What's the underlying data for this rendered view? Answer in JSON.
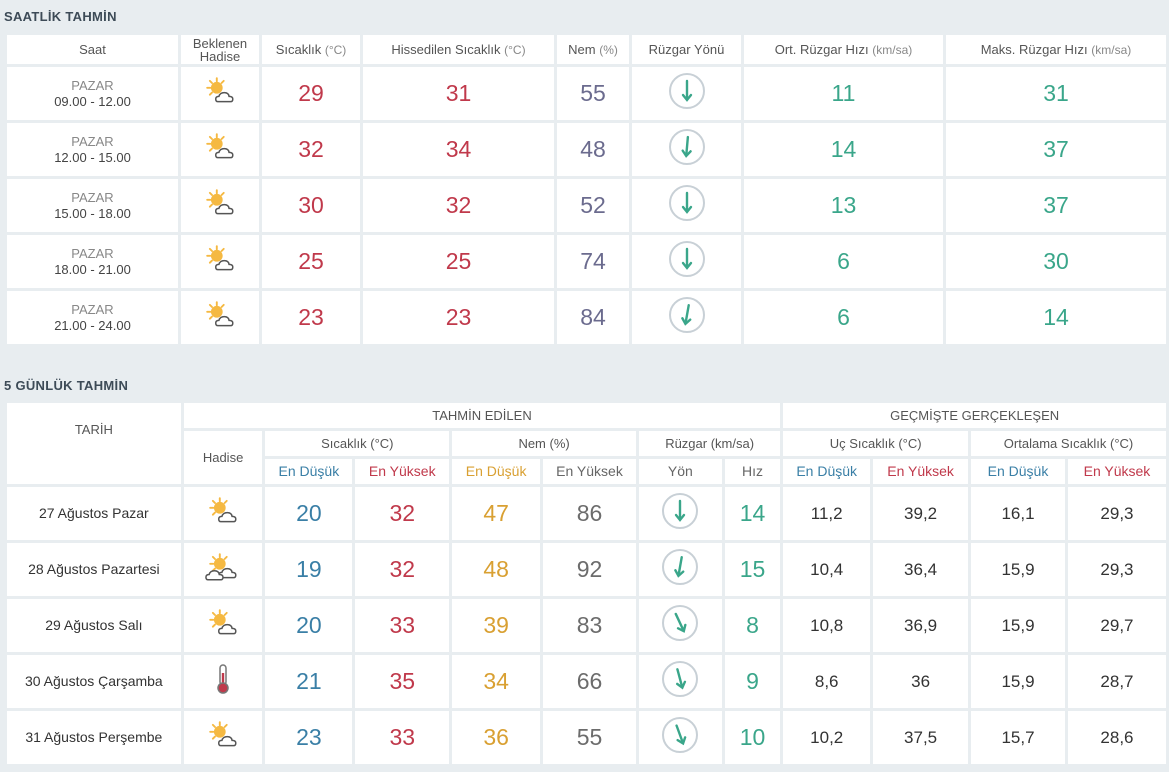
{
  "hourly": {
    "title": "SAATLİK TAHMİN",
    "headers": {
      "time": "Saat",
      "event_line1": "Beklenen",
      "event_line2": "Hadise",
      "temp": "Sıcaklık",
      "temp_unit": "(°C)",
      "feels": "Hissedilen Sıcaklık",
      "feels_unit": "(°C)",
      "humidity": "Nem",
      "humidity_unit": "(%)",
      "wind_dir": "Rüzgar Yönü",
      "avg_wind": "Ort. Rüzgar Hızı",
      "avg_wind_unit": "(km/sa)",
      "max_wind": "Maks. Rüzgar Hızı",
      "max_wind_unit": "(km/sa)"
    },
    "rows": [
      {
        "day": "PAZAR",
        "range": "09.00 - 12.00",
        "icon": "partly-sunny-icon",
        "temp": "29",
        "feels": "31",
        "humidity": "55",
        "wind_rot": 0,
        "avg": "11",
        "max": "31"
      },
      {
        "day": "PAZAR",
        "range": "12.00 - 15.00",
        "icon": "partly-sunny-icon",
        "temp": "32",
        "feels": "34",
        "humidity": "48",
        "wind_rot": 5,
        "avg": "14",
        "max": "37"
      },
      {
        "day": "PAZAR",
        "range": "15.00 - 18.00",
        "icon": "partly-sunny-icon",
        "temp": "30",
        "feels": "32",
        "humidity": "52",
        "wind_rot": 0,
        "avg": "13",
        "max": "37"
      },
      {
        "day": "PAZAR",
        "range": "18.00 - 21.00",
        "icon": "partly-sunny-icon",
        "temp": "25",
        "feels": "25",
        "humidity": "74",
        "wind_rot": 0,
        "avg": "6",
        "max": "30"
      },
      {
        "day": "PAZAR",
        "range": "21.00 - 24.00",
        "icon": "partly-sunny-icon",
        "temp": "23",
        "feels": "23",
        "humidity": "84",
        "wind_rot": 10,
        "avg": "6",
        "max": "14"
      }
    ]
  },
  "daily": {
    "title": "5 GÜNLÜK TAHMİN",
    "headers": {
      "date": "TARİH",
      "forecast": "TAHMİN EDİLEN",
      "past": "GEÇMİŞTE GERÇEKLEŞEN",
      "event": "Hadise",
      "temp": "Sıcaklık (°C)",
      "humidity": "Nem (%)",
      "wind": "Rüzgar (km/sa)",
      "extreme": "Uç Sıcaklık (°C)",
      "average": "Ortalama Sıcaklık (°C)",
      "low": "En Düşük",
      "high": "En Yüksek",
      "dir": "Yön",
      "speed": "Hız"
    },
    "rows": [
      {
        "date": "27 Ağustos Pazar",
        "icon": "partly-sunny-icon",
        "tmin": "20",
        "tmax": "32",
        "hmin": "47",
        "hmax": "86",
        "wind_rot": 0,
        "speed": "14",
        "umin": "11,2",
        "umax": "39,2",
        "amin": "16,1",
        "amax": "29,3"
      },
      {
        "date": "28 Ağustos Pazartesi",
        "icon": "sun-clouds-icon",
        "tmin": "19",
        "tmax": "32",
        "hmin": "48",
        "hmax": "92",
        "wind_rot": 10,
        "speed": "15",
        "umin": "10,4",
        "umax": "36,4",
        "amin": "15,9",
        "amax": "29,3"
      },
      {
        "date": "29 Ağustos Salı",
        "icon": "partly-sunny-icon",
        "tmin": "20",
        "tmax": "33",
        "hmin": "39",
        "hmax": "83",
        "wind_rot": -25,
        "speed": "8",
        "umin": "10,8",
        "umax": "36,9",
        "amin": "15,9",
        "amax": "29,7"
      },
      {
        "date": "30 Ağustos Çarşamba",
        "icon": "thermometer-icon",
        "tmin": "21",
        "tmax": "35",
        "hmin": "34",
        "hmax": "66",
        "wind_rot": -15,
        "speed": "9",
        "umin": "8,6",
        "umax": "36",
        "amin": "15,9",
        "amax": "28,7"
      },
      {
        "date": "31 Ağustos Perşembe",
        "icon": "partly-sunny-icon",
        "tmin": "23",
        "tmax": "33",
        "hmin": "36",
        "hmax": "55",
        "wind_rot": -20,
        "speed": "10",
        "umin": "10,2",
        "umax": "37,5",
        "amin": "15,7",
        "amax": "28,6"
      }
    ]
  }
}
